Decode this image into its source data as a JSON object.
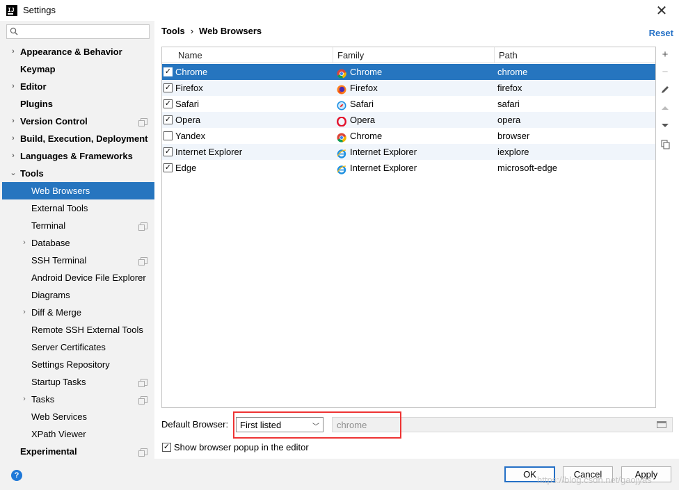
{
  "window": {
    "title": "Settings"
  },
  "search": {
    "placeholder": ""
  },
  "sidebar": {
    "items": [
      {
        "label": "Appearance & Behavior",
        "bold": true,
        "arrow": "›",
        "level": 0,
        "copy": false
      },
      {
        "label": "Keymap",
        "bold": true,
        "arrow": "",
        "level": 0,
        "copy": false
      },
      {
        "label": "Editor",
        "bold": true,
        "arrow": "›",
        "level": 0,
        "copy": false
      },
      {
        "label": "Plugins",
        "bold": true,
        "arrow": "",
        "level": 0,
        "copy": false
      },
      {
        "label": "Version Control",
        "bold": true,
        "arrow": "›",
        "level": 0,
        "copy": true
      },
      {
        "label": "Build, Execution, Deployment",
        "bold": true,
        "arrow": "›",
        "level": 0,
        "copy": false
      },
      {
        "label": "Languages & Frameworks",
        "bold": true,
        "arrow": "›",
        "level": 0,
        "copy": false
      },
      {
        "label": "Tools",
        "bold": true,
        "arrow": "⌄",
        "level": 0,
        "copy": false
      },
      {
        "label": "Web Browsers",
        "bold": false,
        "arrow": "",
        "level": 1,
        "copy": false,
        "selected": true
      },
      {
        "label": "External Tools",
        "bold": false,
        "arrow": "",
        "level": 1,
        "copy": false
      },
      {
        "label": "Terminal",
        "bold": false,
        "arrow": "",
        "level": 1,
        "copy": true
      },
      {
        "label": "Database",
        "bold": false,
        "arrow": "›",
        "level": 1,
        "copy": false
      },
      {
        "label": "SSH Terminal",
        "bold": false,
        "arrow": "",
        "level": 1,
        "copy": true
      },
      {
        "label": "Android Device File Explorer",
        "bold": false,
        "arrow": "",
        "level": 1,
        "copy": false
      },
      {
        "label": "Diagrams",
        "bold": false,
        "arrow": "",
        "level": 1,
        "copy": false
      },
      {
        "label": "Diff & Merge",
        "bold": false,
        "arrow": "›",
        "level": 1,
        "copy": false
      },
      {
        "label": "Remote SSH External Tools",
        "bold": false,
        "arrow": "",
        "level": 1,
        "copy": false
      },
      {
        "label": "Server Certificates",
        "bold": false,
        "arrow": "",
        "level": 1,
        "copy": false
      },
      {
        "label": "Settings Repository",
        "bold": false,
        "arrow": "",
        "level": 1,
        "copy": false
      },
      {
        "label": "Startup Tasks",
        "bold": false,
        "arrow": "",
        "level": 1,
        "copy": true
      },
      {
        "label": "Tasks",
        "bold": false,
        "arrow": "›",
        "level": 1,
        "copy": true
      },
      {
        "label": "Web Services",
        "bold": false,
        "arrow": "",
        "level": 1,
        "copy": false
      },
      {
        "label": "XPath Viewer",
        "bold": false,
        "arrow": "",
        "level": 1,
        "copy": false
      },
      {
        "label": "Experimental",
        "bold": true,
        "arrow": "",
        "level": 0,
        "copy": true
      }
    ]
  },
  "breadcrumb": {
    "parent": "Tools",
    "separator": "›",
    "current": "Web Browsers"
  },
  "reset_label": "Reset",
  "table": {
    "columns": [
      "Name",
      "Family",
      "Path"
    ],
    "rows": [
      {
        "checked": true,
        "name": "Chrome",
        "family": "Chrome",
        "family_icon": "chrome-icon",
        "path": "chrome",
        "selected": true
      },
      {
        "checked": true,
        "name": "Firefox",
        "family": "Firefox",
        "family_icon": "firefox-icon",
        "path": "firefox"
      },
      {
        "checked": true,
        "name": "Safari",
        "family": "Safari",
        "family_icon": "safari-icon",
        "path": "safari"
      },
      {
        "checked": true,
        "name": "Opera",
        "family": "Opera",
        "family_icon": "opera-icon",
        "path": "opera"
      },
      {
        "checked": false,
        "name": "Yandex",
        "family": "Chrome",
        "family_icon": "chrome-icon",
        "path": "browser"
      },
      {
        "checked": true,
        "name": "Internet Explorer",
        "family": "Internet Explorer",
        "family_icon": "ie-icon",
        "path": "iexplore"
      },
      {
        "checked": true,
        "name": "Edge",
        "family": "Internet Explorer",
        "family_icon": "ie-icon",
        "path": "microsoft-edge"
      }
    ]
  },
  "side_toolbar": [
    "add-icon",
    "remove-icon",
    "edit-icon",
    "move-up-icon",
    "move-down-icon",
    "copy-icon"
  ],
  "default_browser": {
    "label": "Default Browser:",
    "selected": "First listed",
    "path_placeholder": "chrome"
  },
  "show_popup": {
    "checked": true,
    "label": "Show browser popup in the editor"
  },
  "buttons": {
    "ok": "OK",
    "cancel": "Cancel",
    "apply": "Apply"
  },
  "watermark": "https://blog.csdn.net/gaojyas",
  "colors": {
    "selection": "#2675bf",
    "accent": "#2470c6",
    "highlight_box": "#e33333"
  }
}
